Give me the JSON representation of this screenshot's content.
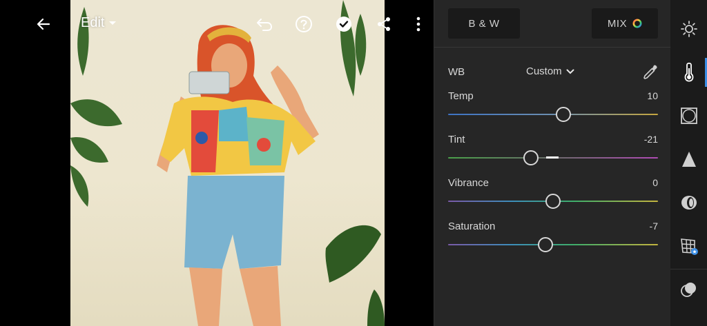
{
  "topbar": {
    "edit_label": "Edit"
  },
  "panel": {
    "bw_label": "B & W",
    "mix_label": "MIX",
    "wb_label": "WB",
    "wb_value": "Custom",
    "sliders": [
      {
        "label": "Temp",
        "value": "10",
        "position": 0.548
      },
      {
        "label": "Tint",
        "value": "-21",
        "position": 0.395
      },
      {
        "label": "Vibrance",
        "value": "0",
        "position": 0.5
      },
      {
        "label": "Saturation",
        "value": "-7",
        "position": 0.465
      }
    ]
  },
  "tools": [
    "light-icon",
    "color-thermometer-icon",
    "effects-icon",
    "detail-icon",
    "optics-icon",
    "geometry-icon",
    "presets-icon"
  ],
  "colors": {
    "panel_bg": "#262626",
    "tool_strip_bg": "#1b1b1b",
    "active_accent": "#3a8ee6"
  }
}
